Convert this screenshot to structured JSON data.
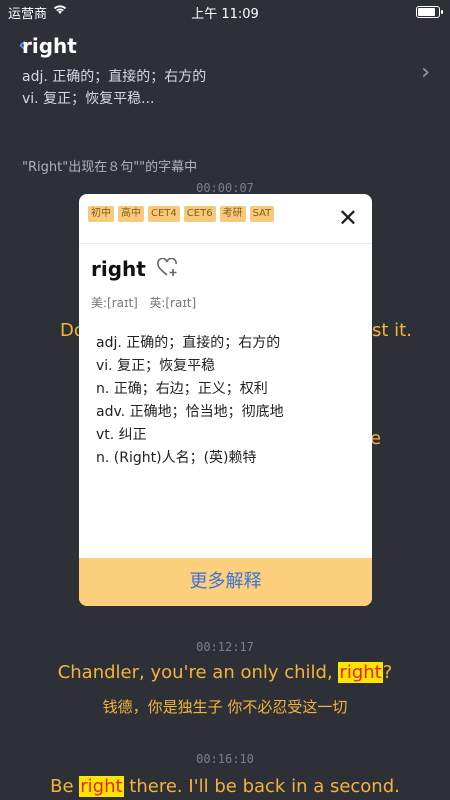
{
  "status_bar": {
    "carrier": "运营商",
    "time": "上午 11:09",
    "battery_level": 0.9
  },
  "header": {
    "word": "right",
    "definitions": [
      "adj. 正确的；直接的；右方的",
      "vi. 复正；恢复平稳..."
    ],
    "occurrence": "\"Right\"出现在８句\"\"的字幕中"
  },
  "subtitles": [
    {
      "time": "00:00:07"
    },
    {
      "time": "00:12:17",
      "en_before": "Chandler, you're an only child, ",
      "en_highlight": "right",
      "en_after": "?",
      "zh": "钱德，你是独生子 你不必忍受这一切"
    },
    {
      "time": "00:16:10",
      "en_before": "Be ",
      "en_highlight": "right",
      "en_after": " there. I'll be back in a second."
    }
  ],
  "partial_lines": {
    "left": "Do",
    "right": "st it.",
    "right2": "e"
  },
  "popup": {
    "tags": [
      "初中",
      "高中",
      "CET4",
      "CET6",
      "考研",
      "SAT"
    ],
    "word": "right",
    "phonetic_us": "美:[raɪt]",
    "phonetic_uk": "英:[raɪt]",
    "definitions": [
      "adj. 正确的；直接的；右方的",
      "vi. 复正；恢复平稳",
      "n. 正确；右边；正义；权利",
      "adv. 正确地；恰当地；彻底地",
      "vt. 纠正",
      "n. (Right)人名；(英)赖特"
    ],
    "more_label": "更多解释"
  },
  "icons": {
    "close": "close-icon",
    "favorite": "heart-plus-icon",
    "chevron": "chevron-right-icon",
    "wifi": "wifi-icon"
  },
  "colors": {
    "accent": "#f3b33d",
    "highlight_bg": "#ffe400",
    "highlight_fg": "#e8232a",
    "button": "#fccf7d",
    "link": "#3a74d6"
  }
}
